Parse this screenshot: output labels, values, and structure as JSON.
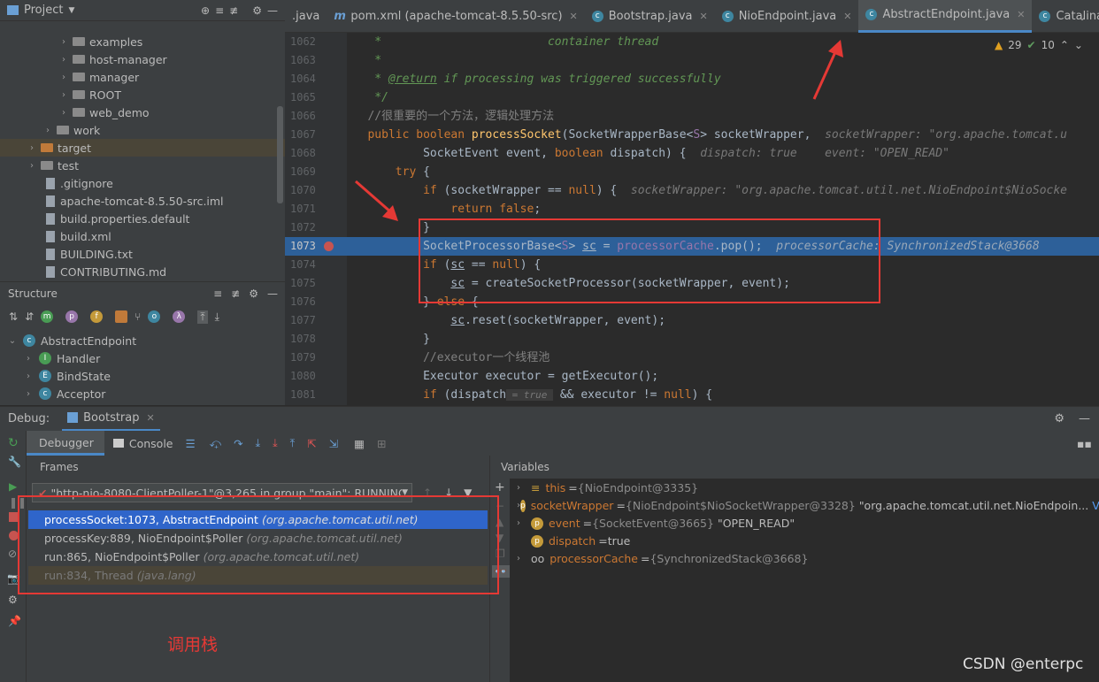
{
  "project_panel": {
    "title": "Project",
    "items": [
      {
        "label": "examples",
        "type": "folder"
      },
      {
        "label": "host-manager",
        "type": "folder"
      },
      {
        "label": "manager",
        "type": "folder"
      },
      {
        "label": "ROOT",
        "type": "folder"
      },
      {
        "label": "web_demo",
        "type": "folder"
      },
      {
        "label": "work",
        "type": "folder"
      },
      {
        "label": "target",
        "type": "folder-orange"
      },
      {
        "label": "test",
        "type": "folder"
      },
      {
        "label": ".gitignore",
        "type": "file"
      },
      {
        "label": "apache-tomcat-8.5.50-src.iml",
        "type": "file"
      },
      {
        "label": "build.properties.default",
        "type": "file"
      },
      {
        "label": "build.xml",
        "type": "file"
      },
      {
        "label": "BUILDING.txt",
        "type": "file"
      },
      {
        "label": "CONTRIBUTING.md",
        "type": "file"
      }
    ]
  },
  "structure_panel": {
    "title": "Structure",
    "items": [
      "AbstractEndpoint",
      "Handler",
      "BindState",
      "Acceptor"
    ]
  },
  "editor_tabs": [
    {
      "label": ".java",
      "active": false
    },
    {
      "label": "pom.xml (apache-tomcat-8.5.50-src)",
      "active": false
    },
    {
      "label": "Bootstrap.java",
      "active": false
    },
    {
      "label": "NioEndpoint.java",
      "active": false
    },
    {
      "label": "AbstractEndpoint.java",
      "active": true
    },
    {
      "label": "Catalina.java",
      "active": false
    }
  ],
  "inspections": {
    "warnings": "29",
    "ok": "10"
  },
  "code": {
    "line_numbers": [
      "1062",
      "1063",
      "1064",
      "1065",
      "1066",
      "1067",
      "1068",
      "1069",
      "1070",
      "1071",
      "1072",
      "1073",
      "1074",
      "1075",
      "1076",
      "1077",
      "1078",
      "1079",
      "1080",
      "1081"
    ],
    "current_line": "1073"
  },
  "debug": {
    "label": "Debug:",
    "config": "Bootstrap",
    "tab_debugger": "Debugger",
    "tab_console": "Console",
    "frames_title": "Frames",
    "variables_title": "Variables",
    "thread": "\"http-nio-8080-ClientPoller-1\"@3,265 in group \"main\": RUNNING",
    "frames": [
      {
        "method": "processSocket:1073, AbstractEndpoint",
        "pkg": "(org.apache.tomcat.util.net)",
        "state": "selected"
      },
      {
        "method": "processKey:889, NioEndpoint$Poller",
        "pkg": "(org.apache.tomcat.util.net)",
        "state": "normal"
      },
      {
        "method": "run:865, NioEndpoint$Poller",
        "pkg": "(org.apache.tomcat.util.net)",
        "state": "normal"
      },
      {
        "method": "run:834, Thread",
        "pkg": "(java.lang)",
        "state": "dim"
      }
    ],
    "variables": [
      {
        "name": "this",
        "value": "{NioEndpoint@3335}",
        "extra": ""
      },
      {
        "name": "socketWrapper",
        "value": "{NioEndpoint$NioSocketWrapper@3328}",
        "extra": "\"org.apache.tomcat.util.net.NioEndpoin...",
        "view": "View"
      },
      {
        "name": "event",
        "value": "{SocketEvent@3665}",
        "extra": "\"OPEN_READ\""
      },
      {
        "name": "dispatch",
        "value": "true",
        "extra": ""
      },
      {
        "name": "processorCache",
        "value": "{SynchronizedStack@3668}",
        "extra": ""
      }
    ]
  },
  "annotation_label": "调用栈",
  "watermark": "CSDN @enterpc",
  "colors": {
    "highlight_line": "#2d6099",
    "annotation_red": "#e53935",
    "selected_frame": "#2f65ca"
  }
}
